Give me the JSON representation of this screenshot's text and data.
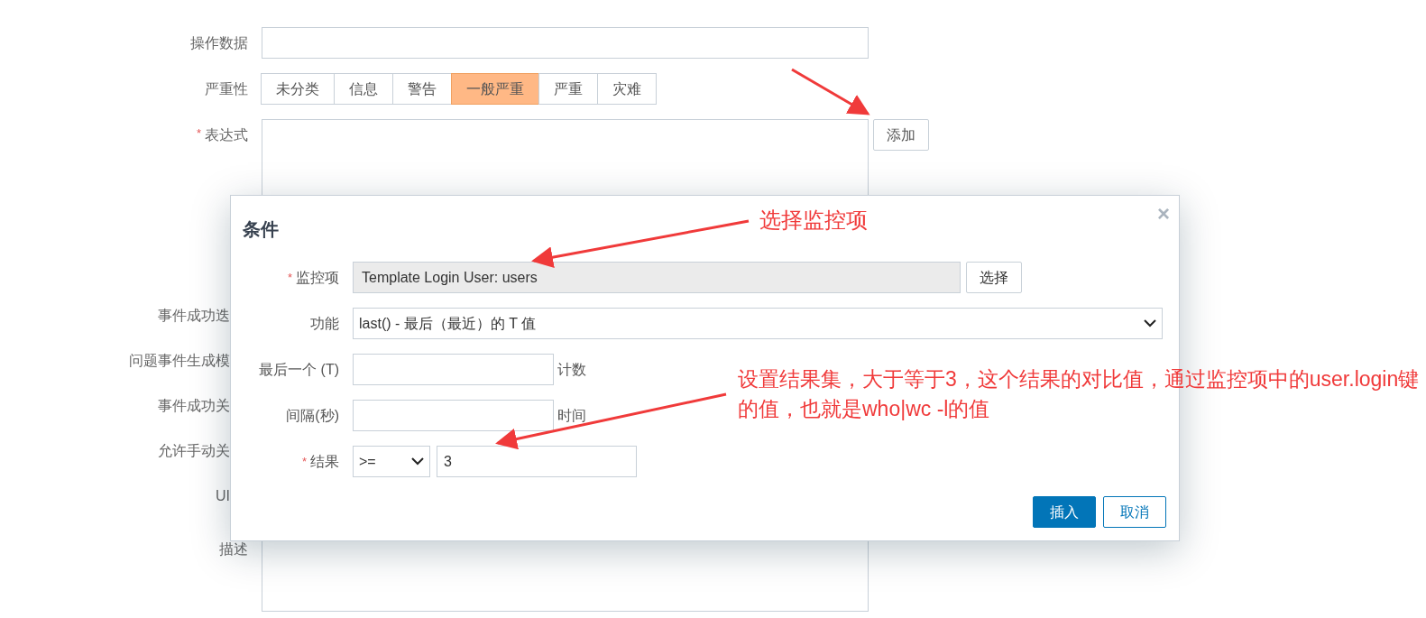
{
  "form": {
    "rows": [
      {
        "kind": "text",
        "label": "操作数据",
        "value": ""
      },
      {
        "kind": "severity",
        "label": "严重性",
        "options": [
          {
            "label": "未分类",
            "selected": false
          },
          {
            "label": "信息",
            "selected": false
          },
          {
            "label": "警告",
            "selected": false
          },
          {
            "label": "一般严重",
            "selected": true
          },
          {
            "label": "严重",
            "selected": false
          },
          {
            "label": "灾难",
            "selected": false
          }
        ]
      },
      {
        "kind": "expression",
        "label": "表达式",
        "required_mark": "*",
        "button": "添加"
      },
      {
        "kind": "covered",
        "label": "事件成功迭"
      },
      {
        "kind": "covered",
        "label": "问题事件生成模"
      },
      {
        "kind": "covered",
        "label": "事件成功关"
      },
      {
        "kind": "covered",
        "label": "允许手动关"
      },
      {
        "kind": "covered",
        "label": "UI"
      },
      {
        "kind": "textarea",
        "label": "描述"
      }
    ]
  },
  "dialog": {
    "title": "条件",
    "close": "×",
    "fields": [
      {
        "kind": "picker",
        "label": "监控项",
        "required_mark": "*",
        "value": "Template Login User: users",
        "button": "选择"
      },
      {
        "kind": "select",
        "label": "功能",
        "value": "last() - 最后（最近）的 T 值"
      },
      {
        "kind": "input",
        "label": "最后一个 (T)",
        "suffix": "计数"
      },
      {
        "kind": "input",
        "label": "间隔(秒)",
        "suffix": "时间"
      },
      {
        "kind": "result",
        "label": "结果",
        "required_mark": "*",
        "operator": ">=",
        "value": "3"
      }
    ],
    "buttons": [
      {
        "label": "插入",
        "primary": true
      },
      {
        "label": "取消",
        "primary": false
      }
    ]
  },
  "annotations": [
    {
      "text": "选择监控项"
    },
    {
      "text": "设置结果集，大于等于3，这个结果的对比值，通过监控项中的user.login键的值，也就是who|wc -l的值"
    }
  ]
}
